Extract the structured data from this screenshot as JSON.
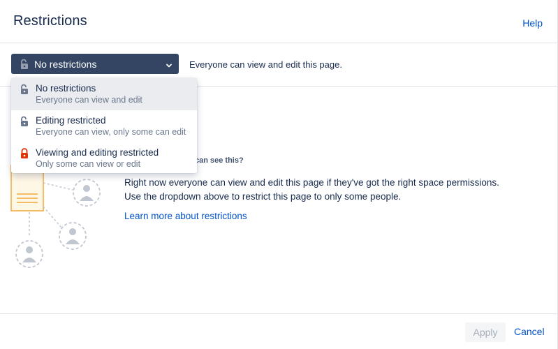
{
  "header": {
    "title": "Restrictions",
    "help_label": "Help"
  },
  "control": {
    "selected_label": "No restrictions",
    "description": "Everyone can view and edit this page."
  },
  "dropdown": {
    "options": [
      {
        "label": "No restrictions",
        "sublabel": "Everyone can view and edit",
        "icon": "unlocked-icon",
        "selected": true
      },
      {
        "label": "Editing restricted",
        "sublabel": "Everyone can view, only some can edit",
        "icon": "unlocked-icon",
        "selected": false
      },
      {
        "label": "Viewing and editing restricted",
        "sublabel": "Only some can view or edit",
        "icon": "locked-icon",
        "selected": false
      }
    ]
  },
  "main": {
    "question": "can see this?",
    "paragraph_line1": "Right now everyone can view and edit this page if they've got the right space permissions.",
    "paragraph_line2": "Use the dropdown above to restrict this page to only some people.",
    "learn_more": "Learn more about restrictions"
  },
  "footer": {
    "apply_label": "Apply",
    "cancel_label": "Cancel"
  },
  "colors": {
    "trigger_bg": "#344563",
    "link": "#0052cc",
    "lock_red": "#de350b",
    "illustration_orange": "#f0a838"
  }
}
